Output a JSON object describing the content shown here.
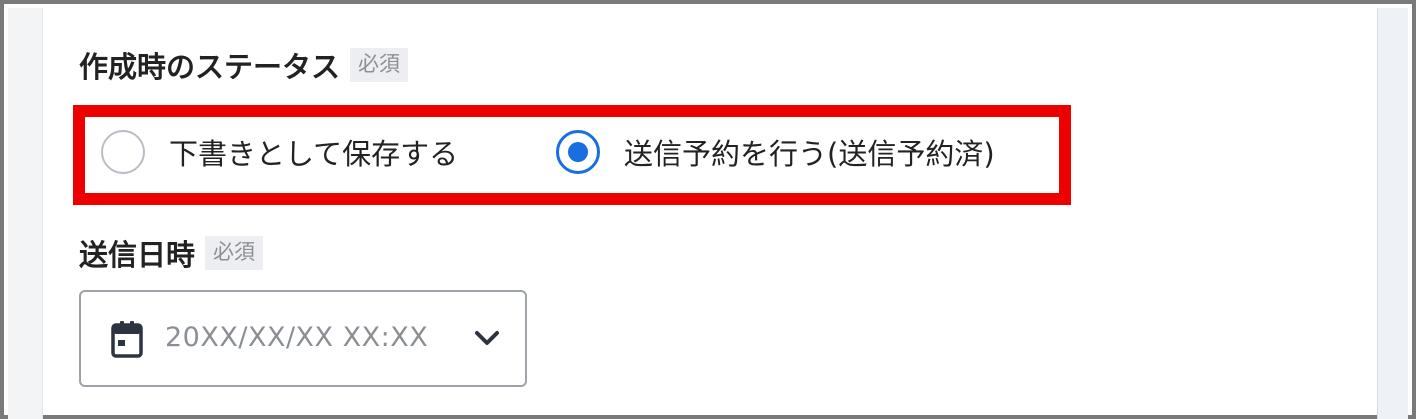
{
  "status_field": {
    "label": "作成時のステータス",
    "required_badge": "必須",
    "options": [
      {
        "label": "下書きとして保存する",
        "selected": false
      },
      {
        "label": "送信予約を行う(送信予約済)",
        "selected": true
      }
    ]
  },
  "datetime_field": {
    "label": "送信日時",
    "required_badge": "必須",
    "placeholder": "20XX/XX/XX  XX:XX",
    "icon": "calendar-icon",
    "dropdown_icon": "chevron-down-icon"
  },
  "colors": {
    "highlight": "#ee0000",
    "accent": "#1a6fe0",
    "placeholder_text": "#8a8f96"
  }
}
